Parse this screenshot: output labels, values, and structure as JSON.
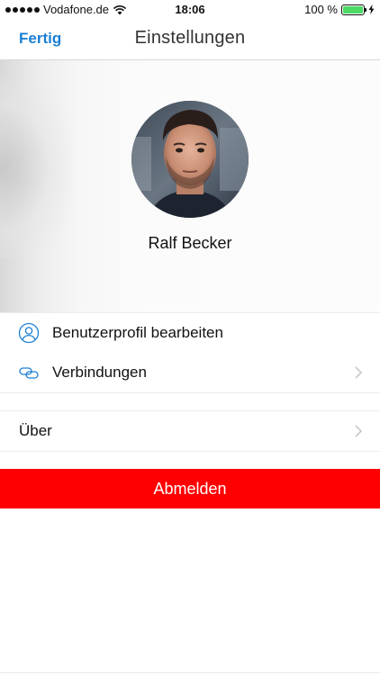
{
  "status_bar": {
    "carrier": "Vodafone.de",
    "time": "18:06",
    "battery_text": "100 %",
    "battery_level": 1.0,
    "signal_icon": "signal-dots-icon",
    "wifi_icon": "wifi-icon",
    "charging_icon": "charging-bolt-icon"
  },
  "nav": {
    "done_label": "Fertig",
    "title": "Einstellungen"
  },
  "profile": {
    "name": "Ralf Becker",
    "avatar_icon": "user-avatar-photo"
  },
  "menu": {
    "items": [
      {
        "label": "Benutzerprofil bearbeiten",
        "icon": "user-outline-icon",
        "has_chevron": false
      },
      {
        "label": "Verbindungen",
        "icon": "link-chain-icon",
        "has_chevron": true
      }
    ],
    "about_label": "Über"
  },
  "logout": {
    "label": "Abmelden"
  },
  "colors": {
    "accent": "#1b7fd4",
    "logout_red": "#ff0000",
    "battery_green": "#4cd964"
  }
}
